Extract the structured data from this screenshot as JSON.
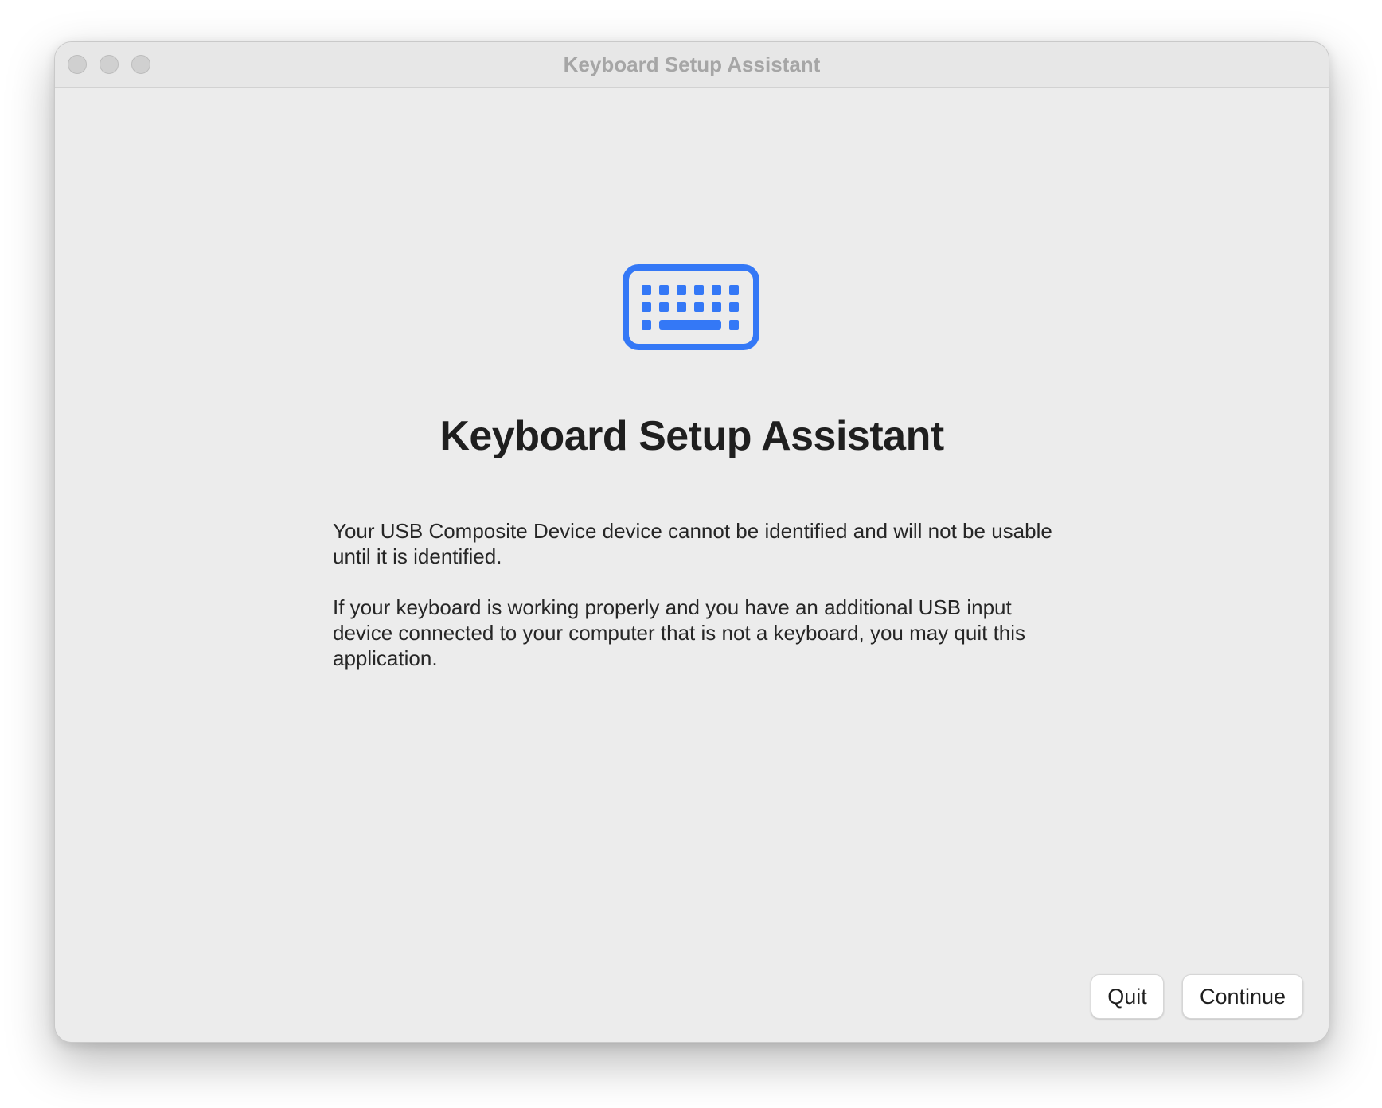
{
  "window": {
    "title": "Keyboard Setup Assistant"
  },
  "main": {
    "icon": "keyboard-icon",
    "heading": "Keyboard Setup Assistant",
    "paragraphs": [
      "Your USB Composite Device device cannot be identified and will not be usable until it is identified.",
      "If your keyboard is working properly and you have an additional USB input device connected to your computer that is not a keyboard, you may quit this application."
    ]
  },
  "footer": {
    "quit_label": "Quit",
    "continue_label": "Continue"
  },
  "colors": {
    "accent": "#3478f6",
    "window_bg": "#ececec",
    "traffic_inactive": "#d0d0d0"
  }
}
